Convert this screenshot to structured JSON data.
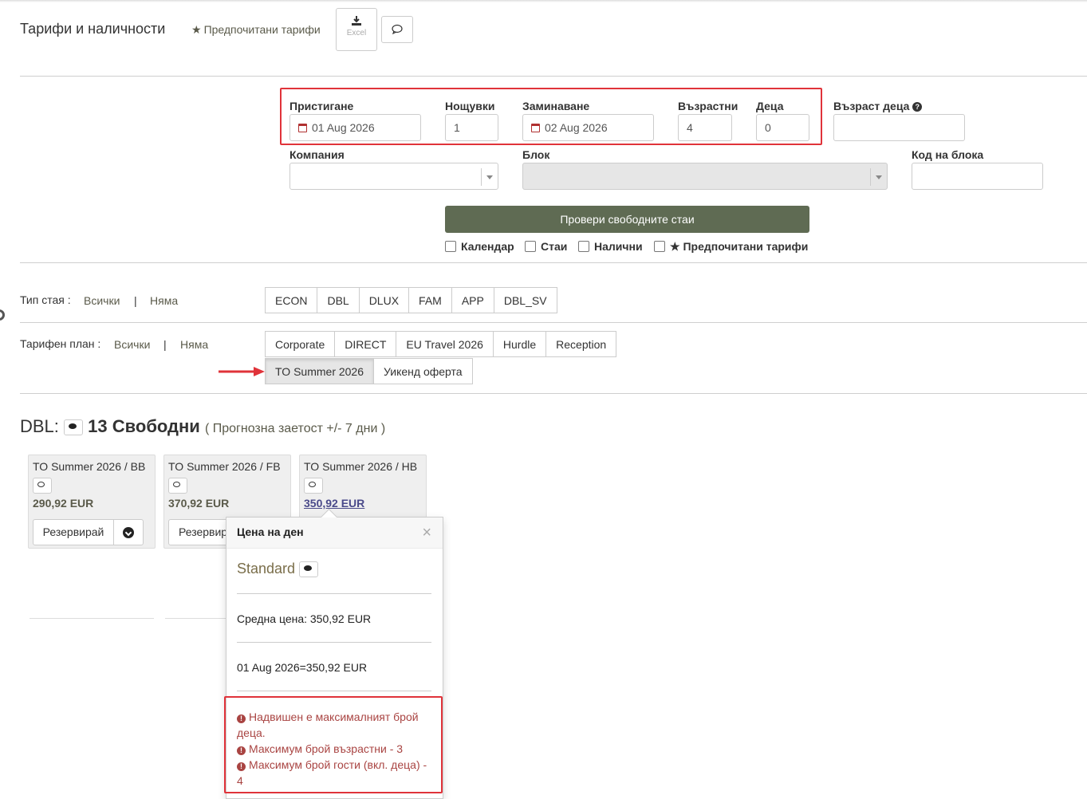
{
  "header": {
    "title": "Тарифи и наличности",
    "favorites_link": "Предпочитани тарифи",
    "excel_label": "Excel"
  },
  "form": {
    "arrival_label": "Пристигане",
    "arrival_value": "01 Aug 2026",
    "nights_label": "Нощувки",
    "nights_value": "1",
    "departure_label": "Заминаване",
    "departure_value": "02 Aug 2026",
    "adults_label": "Възрастни",
    "adults_value": "4",
    "children_label": "Деца",
    "children_value": "0",
    "children_age_label": "Възраст деца",
    "company_label": "Компания",
    "block_label": "Блок",
    "block_code_label": "Код на блока",
    "check_button": "Провери свободните стаи",
    "checkboxes": [
      "Календар",
      "Стаи",
      "Налични",
      "Предпочитани тарифи"
    ]
  },
  "filters": {
    "room_type_label": "Тип стая :",
    "plan_label": "Тарифен план :",
    "all_label": "Всички",
    "none_label": "Няма",
    "separator": "|",
    "room_types": [
      "ECON",
      "DBL",
      "DLUX",
      "FAM",
      "APP",
      "DBL_SV"
    ],
    "plans_row1": [
      "Corporate",
      "DIRECT",
      "EU Travel 2026",
      "Hurdle",
      "Reception"
    ],
    "plans_row2": [
      "TO Summer 2026",
      "Уикенд оферта"
    ],
    "active_plan": "TO Summer 2026"
  },
  "availability": {
    "room": "DBL:",
    "count": "13 Свободни",
    "forecast": "( Прогнозна заетост +/- 7 дни )",
    "cards": [
      {
        "title": "TO Summer 2026 / BB",
        "price": "290,92 EUR",
        "button": "Резервирай"
      },
      {
        "title": "TO Summer 2026 / FB",
        "price": "370,92 EUR",
        "button": "Резервир"
      },
      {
        "title": "TO Summer 2026 / HB",
        "price": "350,92 EUR"
      }
    ]
  },
  "popover": {
    "title": "Цена на ден",
    "close": "×",
    "plan_name": "Standard",
    "avg_price": "Средна цена: 350,92 EUR",
    "day_price": "01 Aug 2026=350,92 EUR",
    "errors": [
      "Надвишен е максималният брой деца.",
      "Максимум брой възрастни - 3",
      "Максимум брой гости (вкл. деца) - 4"
    ]
  },
  "colors": {
    "accent_button": "#5f6b53",
    "highlight_border": "#e0333a",
    "error_text": "#a94442",
    "link_text": "#5a5a4a"
  }
}
